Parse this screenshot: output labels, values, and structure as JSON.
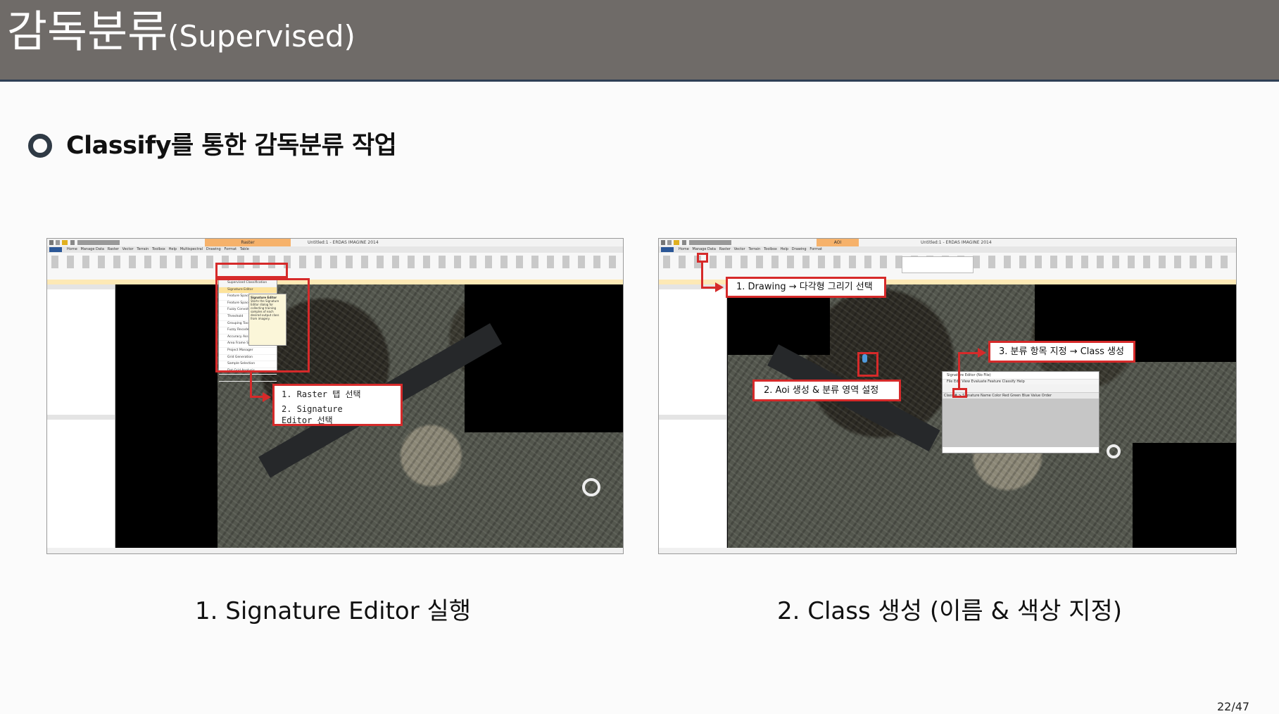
{
  "header": {
    "title_main": "감독분류",
    "title_sub": "(Supervised)"
  },
  "section": {
    "title": "Classify를 통한 감독분류 작업"
  },
  "screenshot1": {
    "window_title": "Untitled:1 - ERDAS IMAGINE 2014",
    "context_tab": "Raster",
    "menu": [
      "Home",
      "Manage Data",
      "Raster",
      "Vector",
      "Terrain",
      "Toolbox",
      "Help",
      "Multispectral",
      "Drawing",
      "Format",
      "Table"
    ],
    "dropdown_items": [
      "Supervised Classification",
      "Signature Editor",
      "Feature Space Image",
      "Feature Space Thematic",
      "Fuzzy Convolution",
      "Threshold",
      "Grouping Tool",
      "Fuzzy Recode",
      "Accuracy Assessment",
      "Area Frame Sampling",
      "Project Manager",
      "Grid Generation",
      "Sample Selection",
      "Dot Grid Analysis",
      "Polygon Analysis"
    ],
    "tooltip_title": "Signature Editor",
    "tooltip_body": "Starts the Signature Editor dialog for collecting training samples of each desired output class from imagery.",
    "annotation": {
      "line1": "1. Raster 탭 선택",
      "line2": "2. Signature",
      "line3": "Editor 선택"
    }
  },
  "screenshot2": {
    "window_title": "Untitled:1 - ERDAS IMAGINE 2014",
    "context_tab": "AOI",
    "menu": [
      "Home",
      "Manage Data",
      "Raster",
      "Vector",
      "Terrain",
      "Toolbox",
      "Help",
      "Drawing",
      "Format"
    ],
    "sig_window_title": "Signature Editor (No File)",
    "sig_menu": "File  Edit  View  Evaluate  Feature  Classify  Help",
    "sig_columns": "Class #   >   Signature Name     Color   Red   Green   Blue   Value   Order",
    "annotations": [
      "1. Drawing → 다각형 그리기 선택",
      "2. Aoi 생성 & 분류 영역 설정",
      "3. 분류 항목 지정 → Class 생성"
    ]
  },
  "captions": [
    "1. Signature Editor 실행",
    "2. Class 생성 (이름 & 색상 지정)"
  ],
  "page": "22/47",
  "colors": {
    "header_bg": "#6f6b68",
    "accent_red": "#d62a2a",
    "bullet": "#2f3a45"
  }
}
